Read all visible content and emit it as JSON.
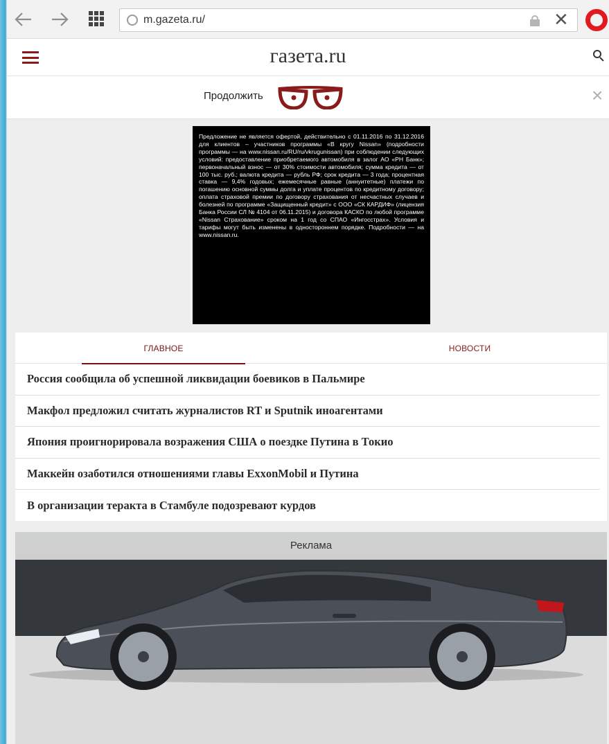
{
  "browser": {
    "url": "m.gazeta.ru/"
  },
  "site": {
    "logo": "газета.ru"
  },
  "continue_banner": {
    "label": "Продолжить"
  },
  "legal_ad": {
    "text": "Предложение не является офертой, действительно с 01.11.2016 по 31.12.2016 для клиентов – участников программы «В кругу Nissan» (подробности программы — на www.nissan.ru/RU/ru/vkrugunissan) при соблюдении следующих условий: предоставление приобретаемого автомобиля в залог АО «РН Банк»; первоначальный взнос — от 30% стоимости автомобиля; сумма кредита — от 100 тыс. руб.; валюта кредита — рубль РФ; срок кредита — 3 года; процентная ставка — 9,4% годовых; ежемесячные равные (аннуитетные) платежи по погашению основной суммы долга и уплате процентов по кредитному договору; оплата страховой премии по договору страхования от несчастных случаев и болезней по программе «Защищенный кредит» с ООО «СК КАРДИФ» (лицензия Банка России СЛ № 4104 от 06.11.2015) и договора КАСКО по любой программе «Nissan Страхование» сроком на 1 год со СПАО «Ингосстрах». Условия и тарифы могут быть изменены в одностороннем порядке. Подробности — на www.nissan.ru."
  },
  "tabs": [
    {
      "label": "ГЛАВНОЕ",
      "active": true
    },
    {
      "label": "НОВОСТИ",
      "active": false
    }
  ],
  "news": [
    "Россия сообщила об успешной ликвидации боевиков в Пальмире",
    "Макфол предложил считать журналистов RT и Sputnik иноагентами",
    "Япония проигнорировала возражения США о поездке Путина в Токио",
    "Маккейн озаботился отношениями главы ExxonMobil и Путина",
    "В организации теракта в Стамбуле подозревают курдов"
  ],
  "car_ad": {
    "label": "Реклама"
  },
  "colors": {
    "brand": "#7a1414",
    "opera": "#e11a21"
  },
  "icons": [
    "back-arrow-icon",
    "forward-arrow-icon",
    "speed-dial-icon",
    "globe-icon",
    "lock-icon",
    "close-icon",
    "opera-icon",
    "menu-icon",
    "search-icon",
    "glasses-icon"
  ]
}
